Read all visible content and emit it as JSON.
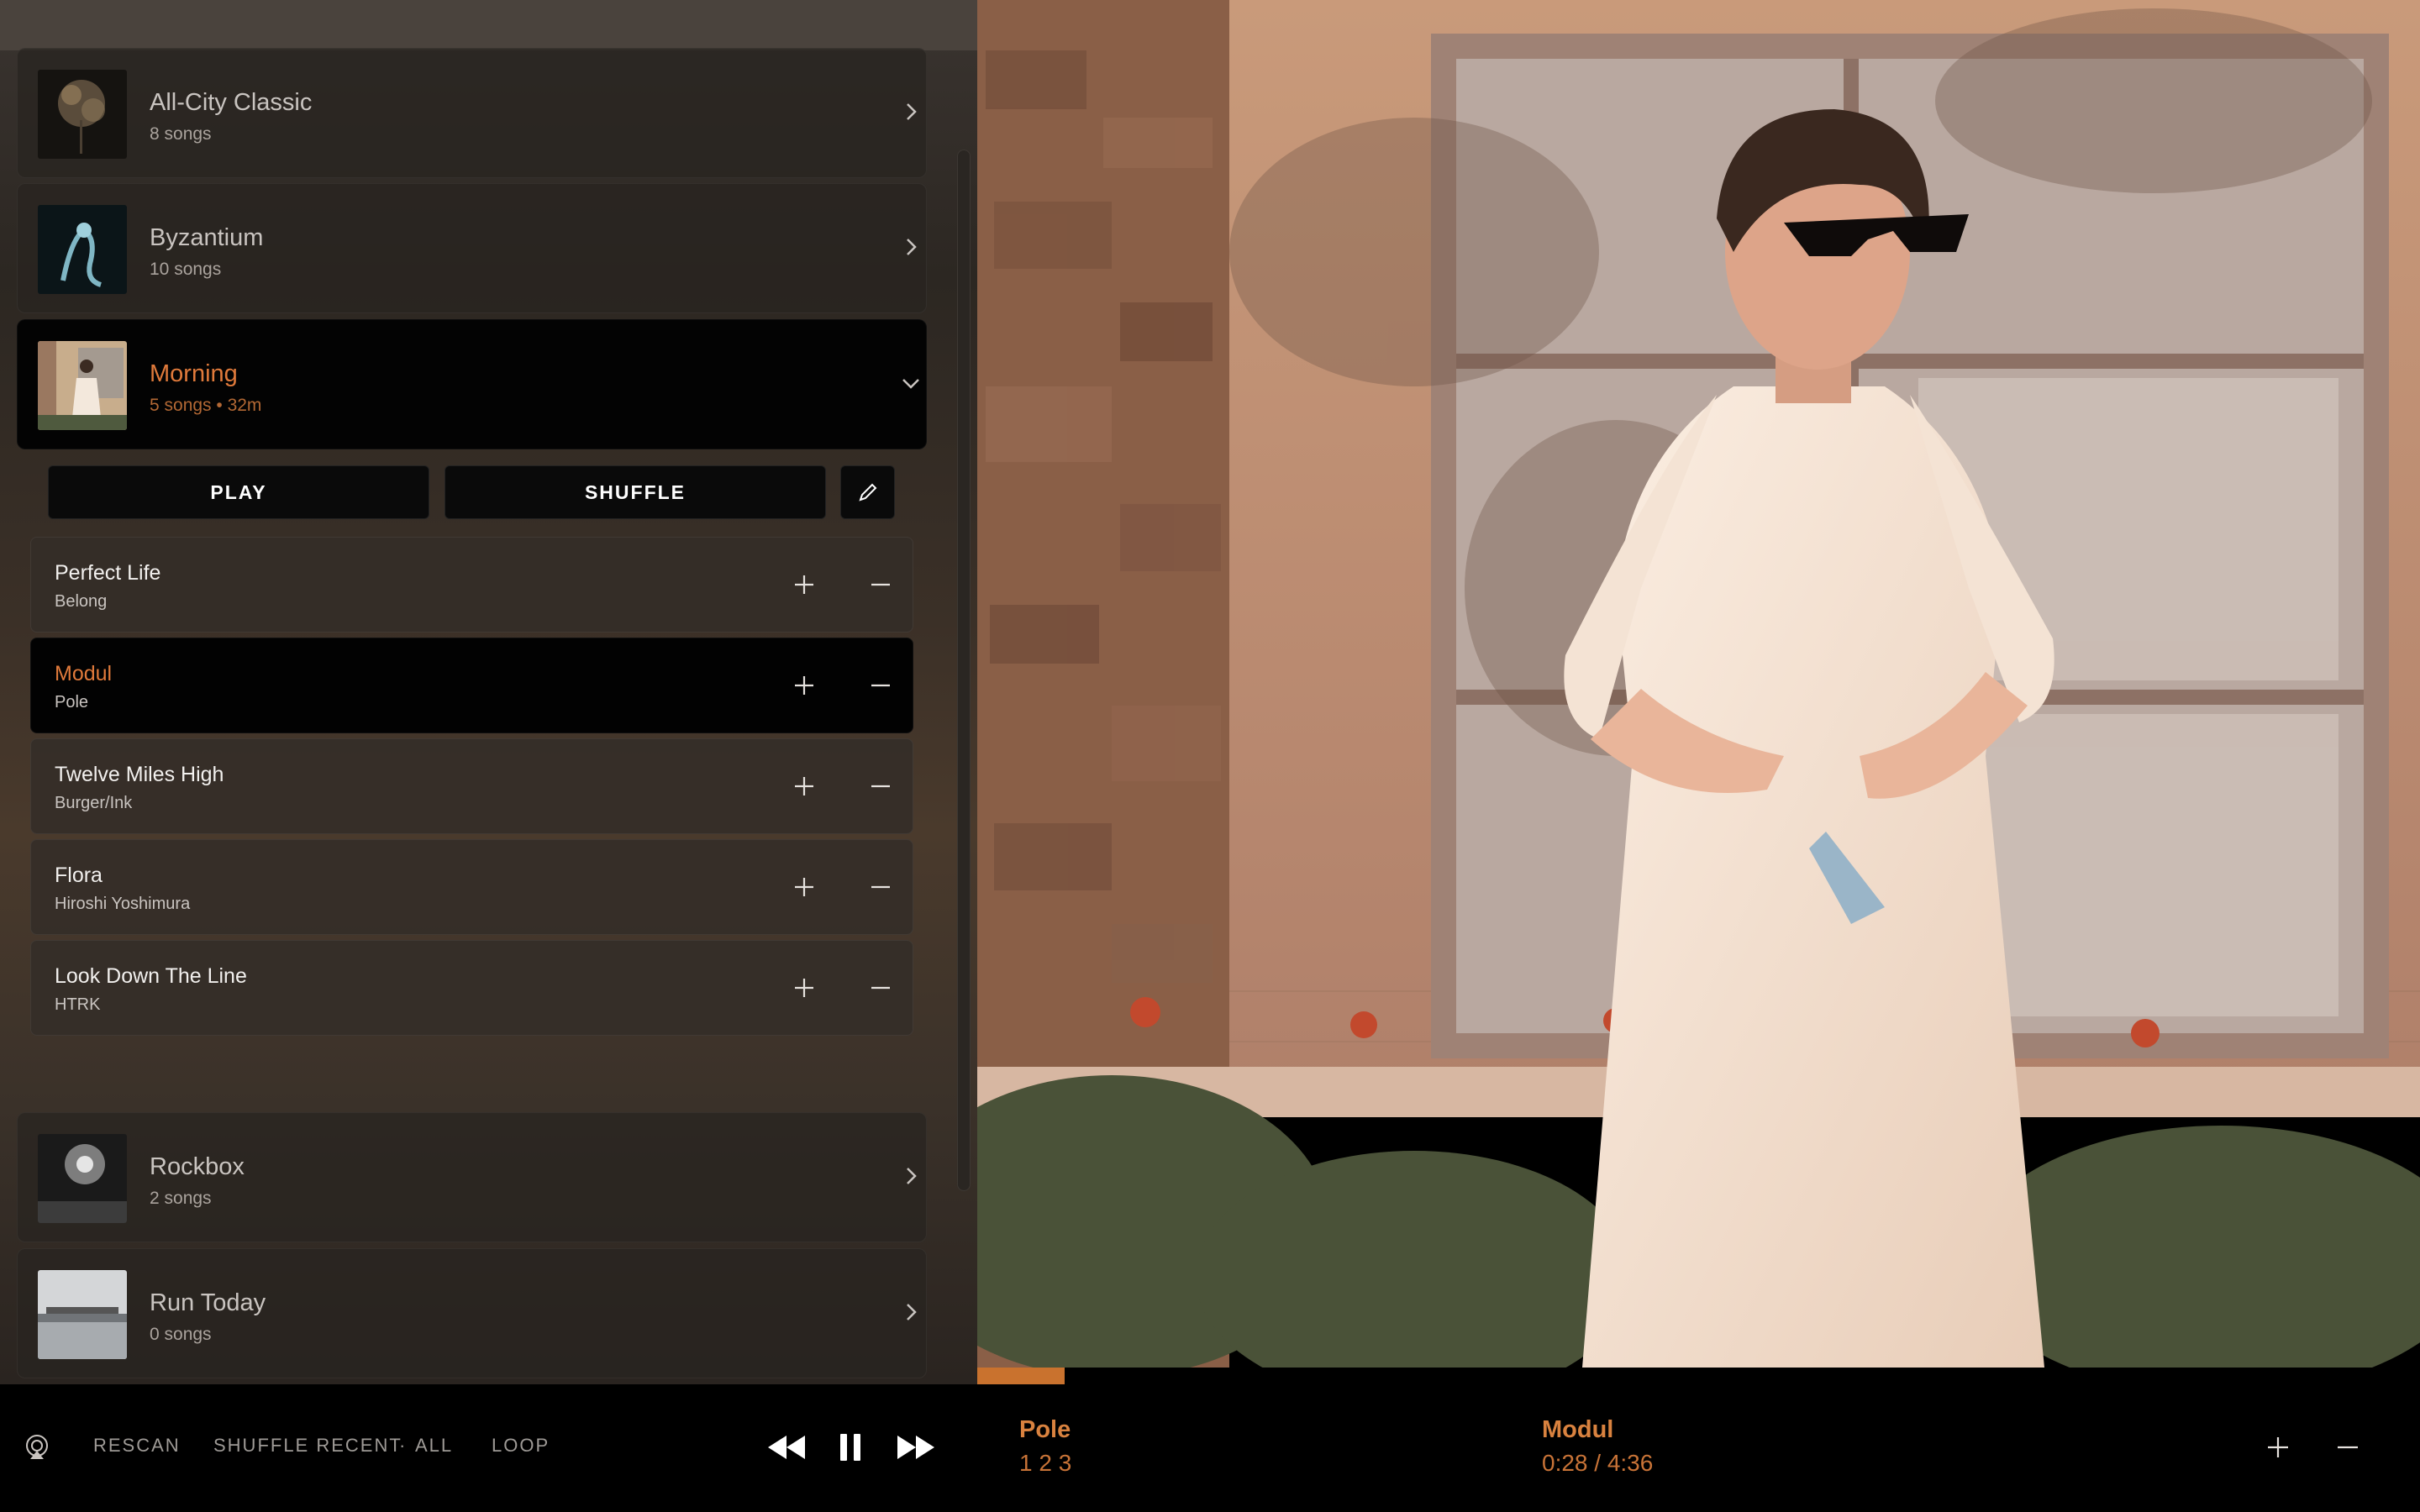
{
  "playlists": [
    {
      "name": "All-City Classic",
      "meta": "8 songs",
      "expanded": false
    },
    {
      "name": "Byzantium",
      "meta": "10 songs",
      "expanded": false
    },
    {
      "name": "Morning",
      "meta": "5 songs • 32m",
      "expanded": true
    },
    {
      "name": "Rockbox",
      "meta": "2 songs",
      "expanded": false
    },
    {
      "name": "Run Today",
      "meta": "0 songs",
      "expanded": false
    }
  ],
  "expanded_actions": {
    "play": "PLAY",
    "shuffle": "SHUFFLE",
    "edit_icon": "pencil-icon"
  },
  "tracks": [
    {
      "title": "Perfect Life",
      "artist": "Belong",
      "active": false
    },
    {
      "title": "Modul",
      "artist": "Pole",
      "active": true
    },
    {
      "title": "Twelve Miles High",
      "artist": "Burger/Ink",
      "active": false
    },
    {
      "title": "Flora",
      "artist": "Hiroshi Yoshimura",
      "active": false
    },
    {
      "title": "Look Down The Line",
      "artist": "HTRK",
      "active": false
    }
  ],
  "bottom_bar": {
    "airplay_icon": "airplay-icon",
    "rescan": "RESCAN",
    "shuffle_recent": "SHUFFLE RECENT",
    "separator": "·",
    "all": "ALL",
    "loop": "LOOP"
  },
  "now_playing": {
    "artist": "Pole",
    "album_numbers": "1 2 3",
    "title": "Modul",
    "time": "0:28 / 4:36",
    "progress": 0.0607
  },
  "colors": {
    "accent": "#e07a3b",
    "progress": "#c9722e",
    "background": "#000000"
  }
}
